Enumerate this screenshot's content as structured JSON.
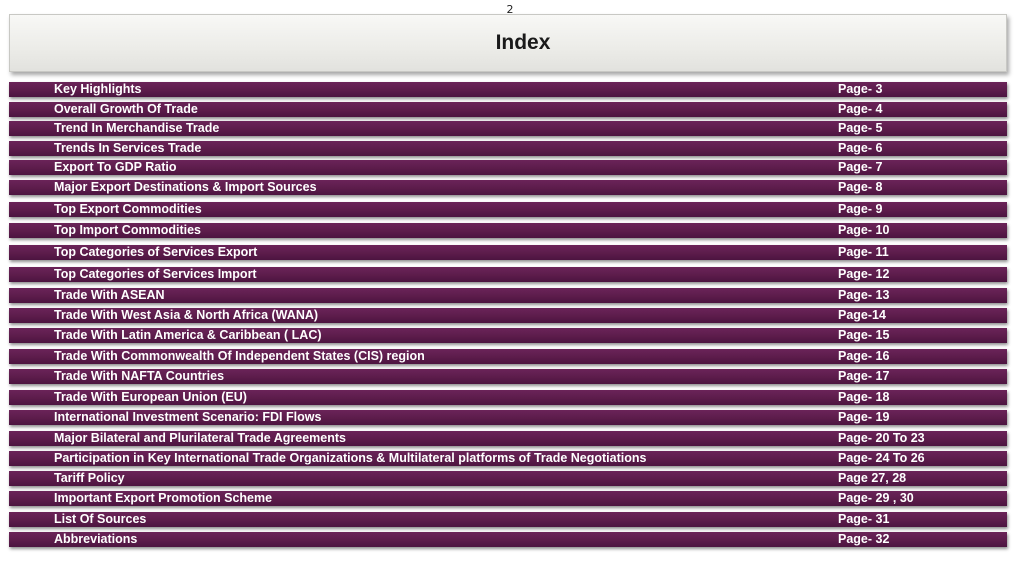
{
  "slide_number": "2",
  "title": "Index",
  "items": [
    {
      "label": "Key Highlights",
      "page": "Page- 3"
    },
    {
      "label": "Overall Growth Of Trade",
      "page": "Page- 4"
    },
    {
      "label": "Trend In Merchandise Trade",
      "page": "Page- 5"
    },
    {
      "label": "Trends In Services Trade",
      "page": "Page- 6"
    },
    {
      "label": "Export To GDP  Ratio",
      "page": "Page- 7"
    },
    {
      "label": "Major Export Destinations & Import Sources",
      "page": "Page- 8"
    },
    {
      "label": "Top Export Commodities",
      "page": "Page- 9"
    },
    {
      "label": "Top Import Commodities",
      "page": "Page- 10"
    },
    {
      "label": "Top  Categories of Services Export",
      "page": "Page- 11"
    },
    {
      "label": "Top  Categories of Services Import",
      "page": "Page- 12"
    },
    {
      "label": "Trade With ASEAN",
      "page": "Page- 13"
    },
    {
      "label": "Trade With West Asia & North Africa (WANA)",
      "page": "Page-14"
    },
    {
      "label": "Trade With Latin America & Caribbean ( LAC)",
      "page": "Page- 15"
    },
    {
      "label": "Trade With Commonwealth Of  Independent States (CIS)  region",
      "page": "Page- 16"
    },
    {
      "label": "Trade With NAFTA Countries",
      "page": "Page- 17"
    },
    {
      "label": "Trade With European Union (EU)",
      "page": "Page- 18"
    },
    {
      "label": "International Investment Scenario: FDI Flows",
      "page": "Page- 19"
    },
    {
      "label": "Major Bilateral and Plurilateral Trade Agreements",
      "page": "Page- 20 To 23"
    },
    {
      "label": "Participation in Key  International Trade Organizations &  Multilateral platforms of Trade Negotiations",
      "page": "Page- 24 To 26"
    },
    {
      "label": "Tariff Policy",
      "page": "Page 27, 28"
    },
    {
      "label": "Important Export Promotion Scheme",
      "page": "Page- 29 , 30"
    },
    {
      "label": "List Of Sources",
      "page": "Page- 31"
    },
    {
      "label": "Abbreviations",
      "page": "Page- 32"
    }
  ]
}
